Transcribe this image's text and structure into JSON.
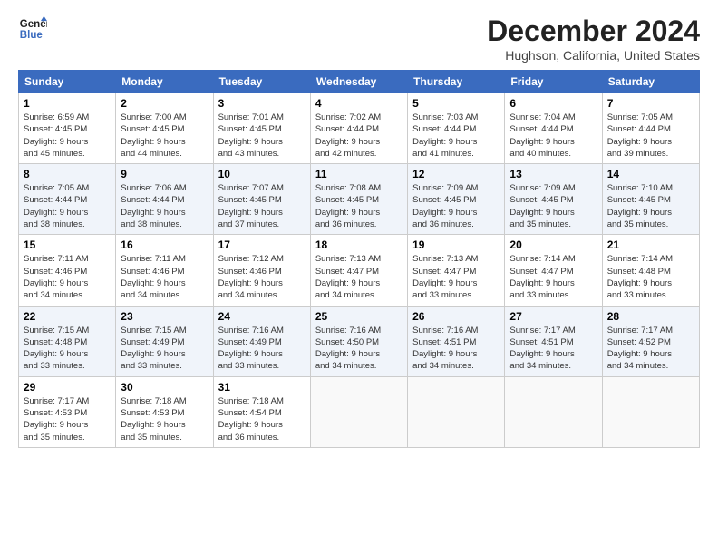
{
  "header": {
    "logo_line1": "General",
    "logo_line2": "Blue",
    "month_year": "December 2024",
    "location": "Hughson, California, United States"
  },
  "weekdays": [
    "Sunday",
    "Monday",
    "Tuesday",
    "Wednesday",
    "Thursday",
    "Friday",
    "Saturday"
  ],
  "weeks": [
    [
      {
        "day": "1",
        "info": "Sunrise: 6:59 AM\nSunset: 4:45 PM\nDaylight: 9 hours\nand 45 minutes."
      },
      {
        "day": "2",
        "info": "Sunrise: 7:00 AM\nSunset: 4:45 PM\nDaylight: 9 hours\nand 44 minutes."
      },
      {
        "day": "3",
        "info": "Sunrise: 7:01 AM\nSunset: 4:45 PM\nDaylight: 9 hours\nand 43 minutes."
      },
      {
        "day": "4",
        "info": "Sunrise: 7:02 AM\nSunset: 4:44 PM\nDaylight: 9 hours\nand 42 minutes."
      },
      {
        "day": "5",
        "info": "Sunrise: 7:03 AM\nSunset: 4:44 PM\nDaylight: 9 hours\nand 41 minutes."
      },
      {
        "day": "6",
        "info": "Sunrise: 7:04 AM\nSunset: 4:44 PM\nDaylight: 9 hours\nand 40 minutes."
      },
      {
        "day": "7",
        "info": "Sunrise: 7:05 AM\nSunset: 4:44 PM\nDaylight: 9 hours\nand 39 minutes."
      }
    ],
    [
      {
        "day": "8",
        "info": "Sunrise: 7:05 AM\nSunset: 4:44 PM\nDaylight: 9 hours\nand 38 minutes."
      },
      {
        "day": "9",
        "info": "Sunrise: 7:06 AM\nSunset: 4:44 PM\nDaylight: 9 hours\nand 38 minutes."
      },
      {
        "day": "10",
        "info": "Sunrise: 7:07 AM\nSunset: 4:45 PM\nDaylight: 9 hours\nand 37 minutes."
      },
      {
        "day": "11",
        "info": "Sunrise: 7:08 AM\nSunset: 4:45 PM\nDaylight: 9 hours\nand 36 minutes."
      },
      {
        "day": "12",
        "info": "Sunrise: 7:09 AM\nSunset: 4:45 PM\nDaylight: 9 hours\nand 36 minutes."
      },
      {
        "day": "13",
        "info": "Sunrise: 7:09 AM\nSunset: 4:45 PM\nDaylight: 9 hours\nand 35 minutes."
      },
      {
        "day": "14",
        "info": "Sunrise: 7:10 AM\nSunset: 4:45 PM\nDaylight: 9 hours\nand 35 minutes."
      }
    ],
    [
      {
        "day": "15",
        "info": "Sunrise: 7:11 AM\nSunset: 4:46 PM\nDaylight: 9 hours\nand 34 minutes."
      },
      {
        "day": "16",
        "info": "Sunrise: 7:11 AM\nSunset: 4:46 PM\nDaylight: 9 hours\nand 34 minutes."
      },
      {
        "day": "17",
        "info": "Sunrise: 7:12 AM\nSunset: 4:46 PM\nDaylight: 9 hours\nand 34 minutes."
      },
      {
        "day": "18",
        "info": "Sunrise: 7:13 AM\nSunset: 4:47 PM\nDaylight: 9 hours\nand 34 minutes."
      },
      {
        "day": "19",
        "info": "Sunrise: 7:13 AM\nSunset: 4:47 PM\nDaylight: 9 hours\nand 33 minutes."
      },
      {
        "day": "20",
        "info": "Sunrise: 7:14 AM\nSunset: 4:47 PM\nDaylight: 9 hours\nand 33 minutes."
      },
      {
        "day": "21",
        "info": "Sunrise: 7:14 AM\nSunset: 4:48 PM\nDaylight: 9 hours\nand 33 minutes."
      }
    ],
    [
      {
        "day": "22",
        "info": "Sunrise: 7:15 AM\nSunset: 4:48 PM\nDaylight: 9 hours\nand 33 minutes."
      },
      {
        "day": "23",
        "info": "Sunrise: 7:15 AM\nSunset: 4:49 PM\nDaylight: 9 hours\nand 33 minutes."
      },
      {
        "day": "24",
        "info": "Sunrise: 7:16 AM\nSunset: 4:49 PM\nDaylight: 9 hours\nand 33 minutes."
      },
      {
        "day": "25",
        "info": "Sunrise: 7:16 AM\nSunset: 4:50 PM\nDaylight: 9 hours\nand 34 minutes."
      },
      {
        "day": "26",
        "info": "Sunrise: 7:16 AM\nSunset: 4:51 PM\nDaylight: 9 hours\nand 34 minutes."
      },
      {
        "day": "27",
        "info": "Sunrise: 7:17 AM\nSunset: 4:51 PM\nDaylight: 9 hours\nand 34 minutes."
      },
      {
        "day": "28",
        "info": "Sunrise: 7:17 AM\nSunset: 4:52 PM\nDaylight: 9 hours\nand 34 minutes."
      }
    ],
    [
      {
        "day": "29",
        "info": "Sunrise: 7:17 AM\nSunset: 4:53 PM\nDaylight: 9 hours\nand 35 minutes."
      },
      {
        "day": "30",
        "info": "Sunrise: 7:18 AM\nSunset: 4:53 PM\nDaylight: 9 hours\nand 35 minutes."
      },
      {
        "day": "31",
        "info": "Sunrise: 7:18 AM\nSunset: 4:54 PM\nDaylight: 9 hours\nand 36 minutes."
      },
      {
        "day": "",
        "info": ""
      },
      {
        "day": "",
        "info": ""
      },
      {
        "day": "",
        "info": ""
      },
      {
        "day": "",
        "info": ""
      }
    ]
  ]
}
